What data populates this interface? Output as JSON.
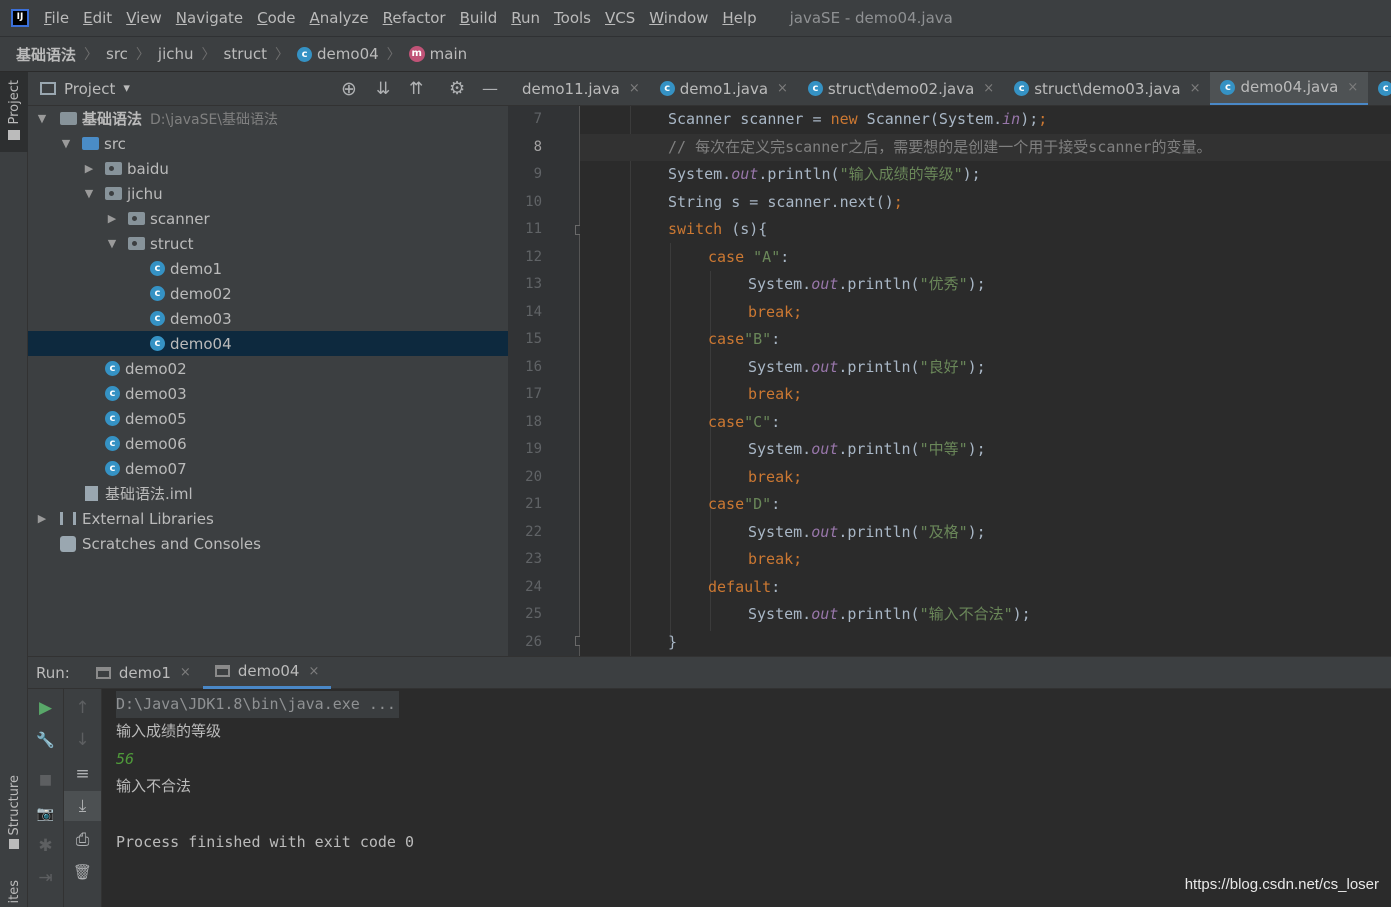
{
  "window": {
    "logo": "IJ",
    "title": "javaSE - demo04.java",
    "menu": [
      "File",
      "Edit",
      "View",
      "Navigate",
      "Code",
      "Analyze",
      "Refactor",
      "Build",
      "Run",
      "Tools",
      "VCS",
      "Window",
      "Help"
    ]
  },
  "breadcrumb": {
    "items": [
      "基础语法",
      "src",
      "jichu",
      "struct",
      "demo04",
      "main"
    ],
    "sep": "〉",
    "class_icon": "c",
    "method_icon": "m"
  },
  "left_stripe": {
    "project": "Project",
    "structure": "Structure",
    "favorites": "ites"
  },
  "project_panel": {
    "title": "Project",
    "dropdown": "▾",
    "actions": {
      "locate": "⊕",
      "expand": "⇊",
      "collapse": "⇈",
      "settings": "⚙",
      "hide": "—"
    }
  },
  "tree": {
    "root_label": "基础语法",
    "root_path": "D:\\javaSE\\基础语法",
    "src": "src",
    "baidu": "baidu",
    "jichu": "jichu",
    "scanner": "scanner",
    "struct": "struct",
    "struct_children": [
      "demo1",
      "demo02",
      "demo03",
      "demo04"
    ],
    "jichu_children": [
      "demo02",
      "demo03",
      "demo05",
      "demo06",
      "demo07"
    ],
    "iml": "基础语法.iml",
    "external": "External Libraries",
    "scratches": "Scratches and Consoles"
  },
  "editor": {
    "tabs": [
      {
        "label": "demo11.java",
        "close": "×"
      },
      {
        "label": "demo1.java",
        "close": "×"
      },
      {
        "label": "struct\\demo02.java",
        "close": "×"
      },
      {
        "label": "struct\\demo03.java",
        "close": "×"
      },
      {
        "label": "demo04.java",
        "close": "×",
        "active": true
      }
    ],
    "line_numbers": [
      "7",
      "8",
      "9",
      "10",
      "11",
      "12",
      "13",
      "14",
      "15",
      "16",
      "17",
      "18",
      "19",
      "20",
      "21",
      "22",
      "23",
      "24",
      "25",
      "26"
    ],
    "current_line": "8",
    "tokens": {
      "scanner_decl": "Scanner scanner = ",
      "kw_new": "new",
      "scanner_ctor": " Scanner(System.",
      "fld_in": "in",
      "close_paren": ");",
      "comment": "// 每次在定义完scanner之后，需要想的是创建一个用于接受scanner的变量。",
      "sys": "System.",
      "fld_out": "out",
      "println": ".println(",
      "str_prompt": "\"输入成绩的等级\"",
      "string_s": "String s = scanner.next()",
      "semi": ";",
      "kw_switch": "switch",
      "switch_rest": " (s){",
      "kw_case": "case",
      "str_a": " \"A\"",
      "str_b": "\"B\"",
      "str_c": "\"C\"",
      "str_d": "\"D\"",
      "colon": ":",
      "str_excellent": "\"优秀\"",
      "str_good": "\"良好\"",
      "str_medium": "\"中等\"",
      "str_pass": "\"及格\"",
      "str_invalid": "\"输入不合法\"",
      "kw_break": "break;",
      "kw_default": "default",
      "brace": "}"
    }
  },
  "run": {
    "label": "Run:",
    "tabs": [
      {
        "label": "demo1",
        "close": "×"
      },
      {
        "label": "demo04",
        "close": "×",
        "active": true
      }
    ],
    "console": {
      "command": "D:\\Java\\JDK1.8\\bin\\java.exe ...",
      "prompt": "输入成绩的等级",
      "input": "56",
      "result": "输入不合法",
      "exit": "Process finished with exit code 0"
    },
    "toolbar_icons": {
      "run": "▶",
      "wrench": "🔧",
      "stop": "■",
      "camera": "📷",
      "bug": "✱",
      "login": "⇥",
      "up": "↑",
      "down": "↓",
      "wrap": "≡",
      "scroll_end": "⤓",
      "print": "⎙",
      "trash": "🗑"
    }
  },
  "watermark": "https://blog.csdn.net/cs_loser",
  "colors": {
    "bg": "#2b2b2b",
    "panel": "#3c3f41",
    "keyword": "#cc7832",
    "string": "#6a8759",
    "field": "#9876aa",
    "comment": "#808080",
    "selection": "#0d293e",
    "accent": "#4a88c7"
  }
}
